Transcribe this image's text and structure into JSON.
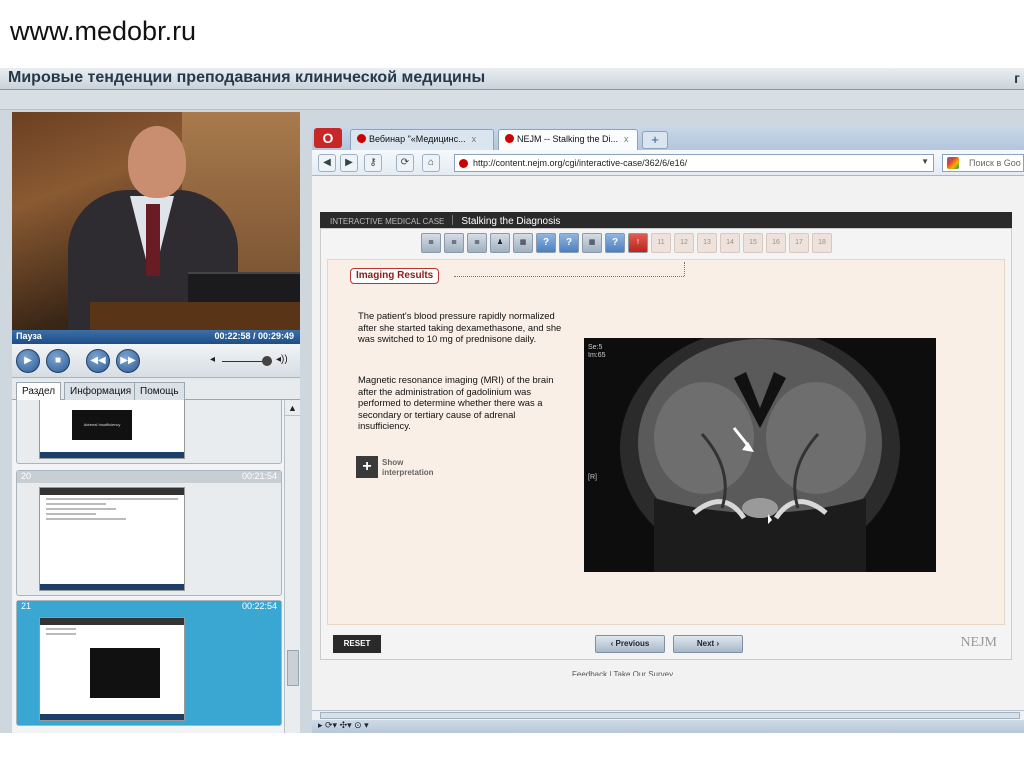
{
  "site_url": "www.medobr.ru",
  "webinar": {
    "title": "Мировые тенденции преподавания клинической медицины",
    "title_right_char": "г"
  },
  "player": {
    "status": "Пауза",
    "time": "00:22:58 / 00:29:49",
    "tabs": [
      "Раздел",
      "Информация",
      "Помощь"
    ],
    "active_tab": "Раздел",
    "volume_icon_low": "◂",
    "volume_icon_high": "◂))",
    "thumbnails": [
      {
        "num": "",
        "time": "",
        "caption": "Adrenal Insufficiency"
      },
      {
        "num": "20",
        "time": "00:21:54"
      },
      {
        "num": "21",
        "time": "00:22:54",
        "selected": true
      }
    ]
  },
  "browser": {
    "logo": "O",
    "tabs": [
      {
        "label": "Вебинар \"«Медицинс...",
        "active": false
      },
      {
        "label": "NEJM -- Stalking the Di...",
        "active": true
      }
    ],
    "new_tab": "+",
    "url": "http://content.nejm.org/cgi/interactive-case/362/6/e16/",
    "search_placeholder": "Поиск в Goo",
    "status_text": "▸  ⟳▾ ✣▾ ⊙ ▾"
  },
  "case": {
    "section_label": "INTERACTIVE MEDICAL CASE",
    "title": "Stalking the Diagnosis",
    "nav_numbers": [
      "11",
      "12",
      "13",
      "14",
      "15",
      "16",
      "17",
      "18"
    ],
    "section_heading": "Imaging Results",
    "paragraph1": "The patient's blood pressure rapidly normalized after she started taking dexamethasone, and she was switched to 10 mg of prednisone daily.",
    "paragraph2": "Magnetic resonance imaging (MRI) of the brain after the administration of gadolinium was performed to determine whether there was a secondary or tertiary cause of adrenal insufficiency.",
    "show_label_line1": "Show",
    "show_label_line2": "interpretation",
    "mri_meta": "Se:5\nIm:65",
    "mri_r": "[R]",
    "reset_label": "RESET",
    "previous_label": "‹  Previous",
    "next_label": "Next  ›",
    "logo": "NEJM",
    "footer_link": "Feedback  |  Take Our Survey"
  },
  "colors": {
    "accent_red": "#b33",
    "header_dark": "#2a2a2a",
    "selection_blue": "#3aa6d2"
  }
}
